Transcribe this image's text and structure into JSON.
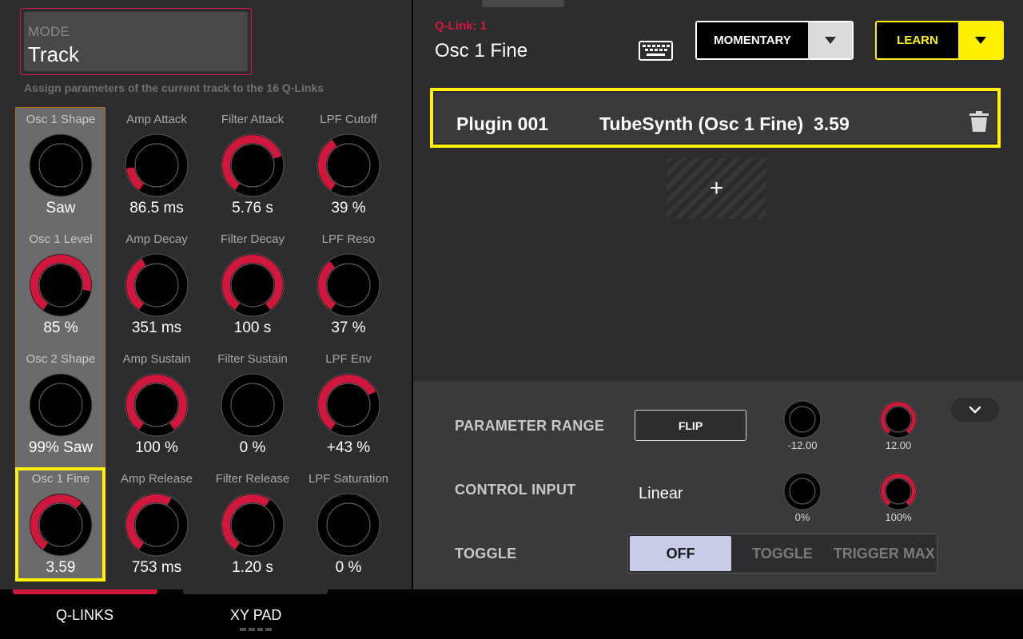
{
  "colors": {
    "accent_red": "#d2173d",
    "highlight_yellow": "#fff200",
    "panel_bg": "#2d2d2f",
    "knob_track": "#000000"
  },
  "mode": {
    "label": "MODE",
    "value": "Track"
  },
  "assign_text": "Assign parameters of the current track to the 16 Q-Links",
  "knobs": [
    {
      "title": "Osc 1 Shape",
      "value": "Saw",
      "level": 0.0
    },
    {
      "title": "Amp Attack",
      "value": "86.5 ms",
      "level": 0.17
    },
    {
      "title": "Filter Attack",
      "value": "5.76 s",
      "level": 0.75
    },
    {
      "title": "LPF Cutoff",
      "value": "39 %",
      "level": 0.39
    },
    {
      "title": "Osc 1 Level",
      "value": "85 %",
      "level": 0.85
    },
    {
      "title": "Amp Decay",
      "value": "351 ms",
      "level": 0.4
    },
    {
      "title": "Filter Decay",
      "value": "100 s",
      "level": 1.0
    },
    {
      "title": "LPF Reso",
      "value": "37 %",
      "level": 0.37
    },
    {
      "title": "Osc 2 Shape",
      "value": "99% Saw",
      "level": 0.0
    },
    {
      "title": "Amp Sustain",
      "value": "100 %",
      "level": 1.0
    },
    {
      "title": "Filter Sustain",
      "value": "0 %",
      "level": 0.0
    },
    {
      "title": "LPF Env",
      "value": "+43 %",
      "level": 0.72
    },
    {
      "title": "Osc 1 Fine",
      "value": "3.59",
      "level": 0.65
    },
    {
      "title": "Amp Release",
      "value": "753 ms",
      "level": 0.6
    },
    {
      "title": "Filter Release",
      "value": "1.20 s",
      "level": 0.62
    },
    {
      "title": "LPF Saturation",
      "value": "0 %",
      "level": 0.0
    }
  ],
  "qlink": {
    "label": "Q-Link: 1",
    "param": "Osc 1 Fine"
  },
  "icons": {
    "keyboard": "keyboard-icon",
    "trash": "trash-icon",
    "dropdown": "chevron-down-icon"
  },
  "momentary": {
    "label": "MOMENTARY"
  },
  "learn": {
    "label": "LEARN"
  },
  "assignment": {
    "plugin": "Plugin 001",
    "param": "TubeSynth (Osc 1 Fine)",
    "value": "3.59"
  },
  "add_label": "+",
  "parameter_range": {
    "label": "PARAMETER RANGE",
    "flip": "FLIP",
    "min": "-12.00",
    "max": "12.00",
    "min_level": 0.0,
    "max_level": 1.0
  },
  "control_input": {
    "label": "CONTROL INPUT",
    "value": "Linear",
    "min": "0%",
    "max": "100%",
    "min_level": 0.0,
    "max_level": 1.0
  },
  "toggle": {
    "label": "TOGGLE",
    "options": [
      "OFF",
      "TOGGLE",
      "TRIGGER MAX"
    ],
    "selected": "OFF"
  },
  "tabs": {
    "qlinks": "Q-LINKS",
    "xypad": "XY PAD"
  }
}
